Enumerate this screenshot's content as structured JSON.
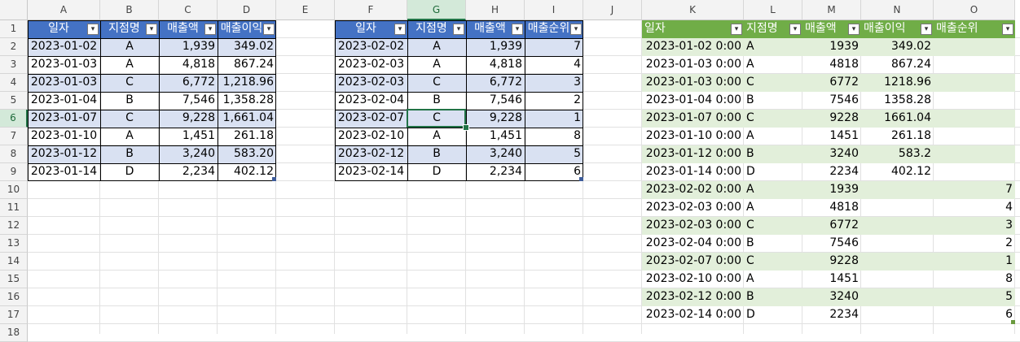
{
  "columns": [
    "A",
    "B",
    "C",
    "D",
    "E",
    "F",
    "G",
    "H",
    "I",
    "J",
    "K",
    "L",
    "M",
    "N",
    "O"
  ],
  "rows": [
    "1",
    "2",
    "3",
    "4",
    "5",
    "6",
    "7",
    "8",
    "9",
    "10",
    "11",
    "12",
    "13",
    "14",
    "15",
    "16",
    "17",
    "18"
  ],
  "selected_cell": "G6",
  "table1": {
    "headers": [
      "일자",
      "지점명",
      "매출액",
      "매출이익"
    ],
    "rows": [
      [
        "2023-01-02",
        "A",
        "1,939",
        "349.02"
      ],
      [
        "2023-01-03",
        "A",
        "4,818",
        "867.24"
      ],
      [
        "2023-01-03",
        "C",
        "6,772",
        "1,218.96"
      ],
      [
        "2023-01-04",
        "B",
        "7,546",
        "1,358.28"
      ],
      [
        "2023-01-07",
        "C",
        "9,228",
        "1,661.04"
      ],
      [
        "2023-01-10",
        "A",
        "1,451",
        "261.18"
      ],
      [
        "2023-01-12",
        "B",
        "3,240",
        "583.20"
      ],
      [
        "2023-01-14",
        "D",
        "2,234",
        "402.12"
      ]
    ]
  },
  "table2": {
    "headers": [
      "일자",
      "지점명",
      "매출액",
      "매출순위"
    ],
    "rows": [
      [
        "2023-02-02",
        "A",
        "1,939",
        "7"
      ],
      [
        "2023-02-03",
        "A",
        "4,818",
        "4"
      ],
      [
        "2023-02-03",
        "C",
        "6,772",
        "3"
      ],
      [
        "2023-02-04",
        "B",
        "7,546",
        "2"
      ],
      [
        "2023-02-07",
        "C",
        "9,228",
        "1"
      ],
      [
        "2023-02-10",
        "A",
        "1,451",
        "8"
      ],
      [
        "2023-02-12",
        "B",
        "3,240",
        "5"
      ],
      [
        "2023-02-14",
        "D",
        "2,234",
        "6"
      ]
    ]
  },
  "table3": {
    "headers": [
      "일자",
      "지점명",
      "매출액",
      "매출이익",
      "매출순위"
    ],
    "rows": [
      [
        "2023-01-02 0:00",
        "A",
        "1939",
        "349.02",
        ""
      ],
      [
        "2023-01-03 0:00",
        "A",
        "4818",
        "867.24",
        ""
      ],
      [
        "2023-01-03 0:00",
        "C",
        "6772",
        "1218.96",
        ""
      ],
      [
        "2023-01-04 0:00",
        "B",
        "7546",
        "1358.28",
        ""
      ],
      [
        "2023-01-07 0:00",
        "C",
        "9228",
        "1661.04",
        ""
      ],
      [
        "2023-01-10 0:00",
        "A",
        "1451",
        "261.18",
        ""
      ],
      [
        "2023-01-12 0:00",
        "B",
        "3240",
        "583.2",
        ""
      ],
      [
        "2023-01-14 0:00",
        "D",
        "2234",
        "402.12",
        ""
      ],
      [
        "2023-02-02 0:00",
        "A",
        "1939",
        "",
        "7"
      ],
      [
        "2023-02-03 0:00",
        "A",
        "4818",
        "",
        "4"
      ],
      [
        "2023-02-03 0:00",
        "C",
        "6772",
        "",
        "3"
      ],
      [
        "2023-02-04 0:00",
        "B",
        "7546",
        "",
        "2"
      ],
      [
        "2023-02-07 0:00",
        "C",
        "9228",
        "",
        "1"
      ],
      [
        "2023-02-10 0:00",
        "A",
        "1451",
        "",
        "8"
      ],
      [
        "2023-02-12 0:00",
        "B",
        "3240",
        "",
        "5"
      ],
      [
        "2023-02-14 0:00",
        "D",
        "2234",
        "",
        "6"
      ]
    ]
  },
  "icons": {
    "filter_dropdown": "chevron-down-icon"
  },
  "colors": {
    "blue_header": "#4472c4",
    "blue_band": "#d9e1f2",
    "green_header": "#70ad47",
    "green_band": "#e2efda",
    "selection": "#217346"
  }
}
